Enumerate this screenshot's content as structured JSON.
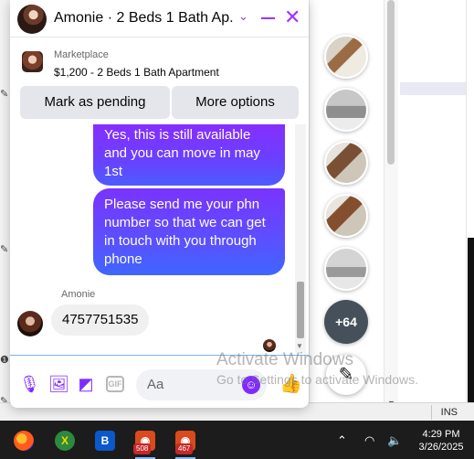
{
  "chat": {
    "title": "Amonie · 2 Beds 1 Bath Ap...",
    "listing_source": "Marketplace",
    "listing_title": "$1,200 - 2 Beds 1 Bath Apartment",
    "actions": {
      "mark_pending": "Mark as pending",
      "more_options": "More options"
    },
    "messages": [
      {
        "from": "me",
        "text": "Yes, this is still available and you can move in may 1st"
      },
      {
        "from": "me",
        "text": "Please send me your phn number so that we can get in touch with you through phone"
      },
      {
        "from": "Amonie",
        "text": "4757751535"
      }
    ],
    "sender_name": "Amonie",
    "composer_placeholder": "Aa"
  },
  "chat_heads": {
    "more_count": "+64"
  },
  "watermark": {
    "title": "Activate Windows",
    "subtitle": "Go to Settings to activate Windows."
  },
  "statusbar": {
    "mode": "INS"
  },
  "taskbar": {
    "badges": [
      "508",
      "467"
    ],
    "time": "4:29 PM",
    "date": "3/26/2025"
  },
  "colors": {
    "accent": "#8a2bff",
    "bubble_gradient_end": "#3f66ff"
  }
}
